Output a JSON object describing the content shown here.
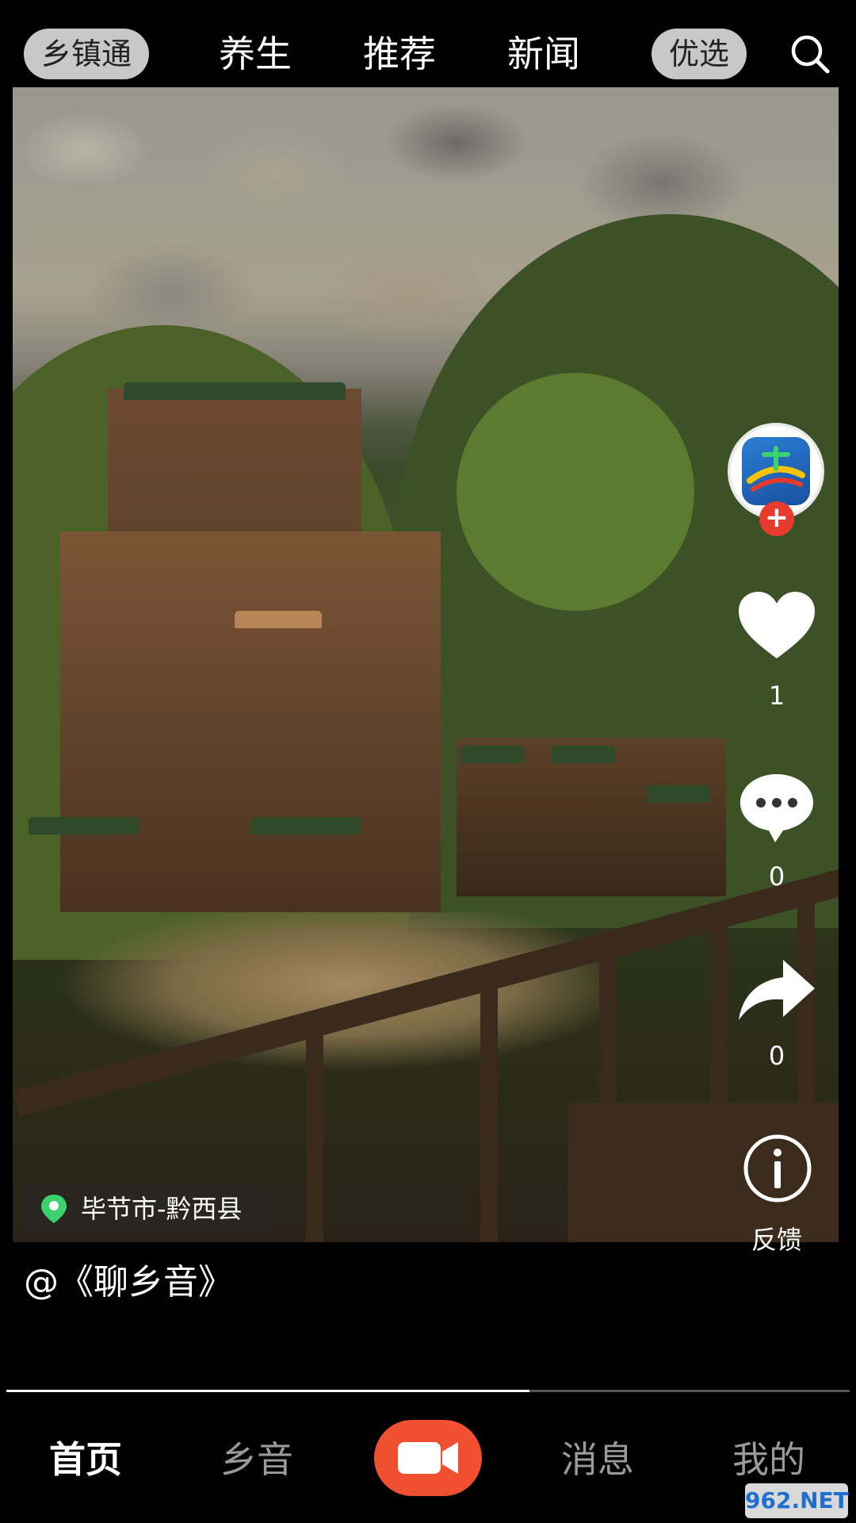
{
  "top_nav": {
    "pill_left": "乡镇通",
    "tabs": [
      "养生",
      "推荐",
      "新闻"
    ],
    "pill_right": "优选",
    "search_icon": "search-icon"
  },
  "video": {
    "location": "毕节市-黔西县",
    "caption": "@《聊乡音》",
    "progress_percent": 62
  },
  "actions": {
    "like_count": "1",
    "comment_count": "0",
    "share_count": "0",
    "feedback_label": "反馈"
  },
  "bottom_nav": {
    "home": "首页",
    "xiangyin": "乡音",
    "messages": "消息",
    "mine": "我的"
  },
  "watermark": "962.NET",
  "colors": {
    "accent_red": "#f0502f",
    "follow_red": "#e63b2e",
    "pill_gray": "#c8c8c8"
  }
}
